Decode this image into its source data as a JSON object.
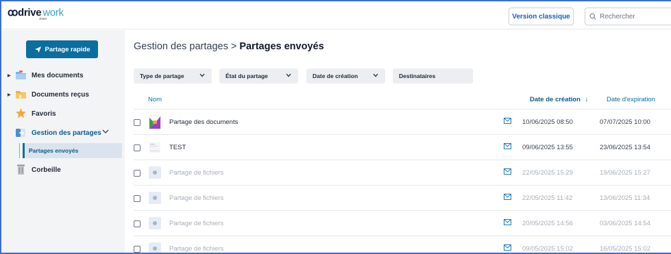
{
  "header": {
    "logo_main": "ꝏdrive",
    "logo_work": "work",
    "logo_sub": "share",
    "classic_version_label": "Version classique",
    "search_placeholder": "Rechercher"
  },
  "sidebar": {
    "quick_share_label": "Partage rapide",
    "items": [
      {
        "label": "Mes documents",
        "icon": "folder-icon"
      },
      {
        "label": "Documents reçus",
        "icon": "received-folder-icon"
      },
      {
        "label": "Favoris",
        "icon": "star-icon"
      },
      {
        "label": "Gestion des partages",
        "icon": "share-management-icon"
      },
      {
        "label": "Corbeille",
        "icon": "trash-icon"
      }
    ],
    "sub_item_label": "Partages envoyés"
  },
  "main": {
    "breadcrumb_parent": "Gestion des partages",
    "breadcrumb_sep": ">",
    "breadcrumb_current": "Partages envoyés",
    "filters": [
      "Type de partage",
      "État du partage",
      "Date de création",
      "Destinataires"
    ],
    "columns": {
      "name": "Nom",
      "created": "Date de création",
      "sort_arrow": "↓",
      "expires": "Date d'expiration"
    },
    "rows": [
      {
        "name": "Partage des documents",
        "created": "10/06/2025 08:50",
        "expires": "07/07/2025 10:00",
        "state": "active"
      },
      {
        "name": "TEST",
        "created": "09/06/2025 13:55",
        "expires": "23/06/2025 13:54",
        "state": "active"
      },
      {
        "name": "Partage de fichiers",
        "created": "22/05/2025 15:29",
        "expires": "19/06/2025 15:27",
        "state": "expired"
      },
      {
        "name": "Partage de fichiers",
        "created": "22/05/2025 11:42",
        "expires": "13/06/2025 11:34",
        "state": "expired"
      },
      {
        "name": "Partage de fichiers",
        "created": "20/05/2025 14:56",
        "expires": "03/06/2025 14:54",
        "state": "expired"
      },
      {
        "name": "Partage de fichiers",
        "created": "09/05/2025 15:02",
        "expires": "16/05/2025 15:02",
        "state": "expired"
      }
    ]
  },
  "colors": {
    "brand": "#0b6e9f",
    "sidebar_bg": "#f3f4f6",
    "frame_border": "#3b6fd1"
  }
}
